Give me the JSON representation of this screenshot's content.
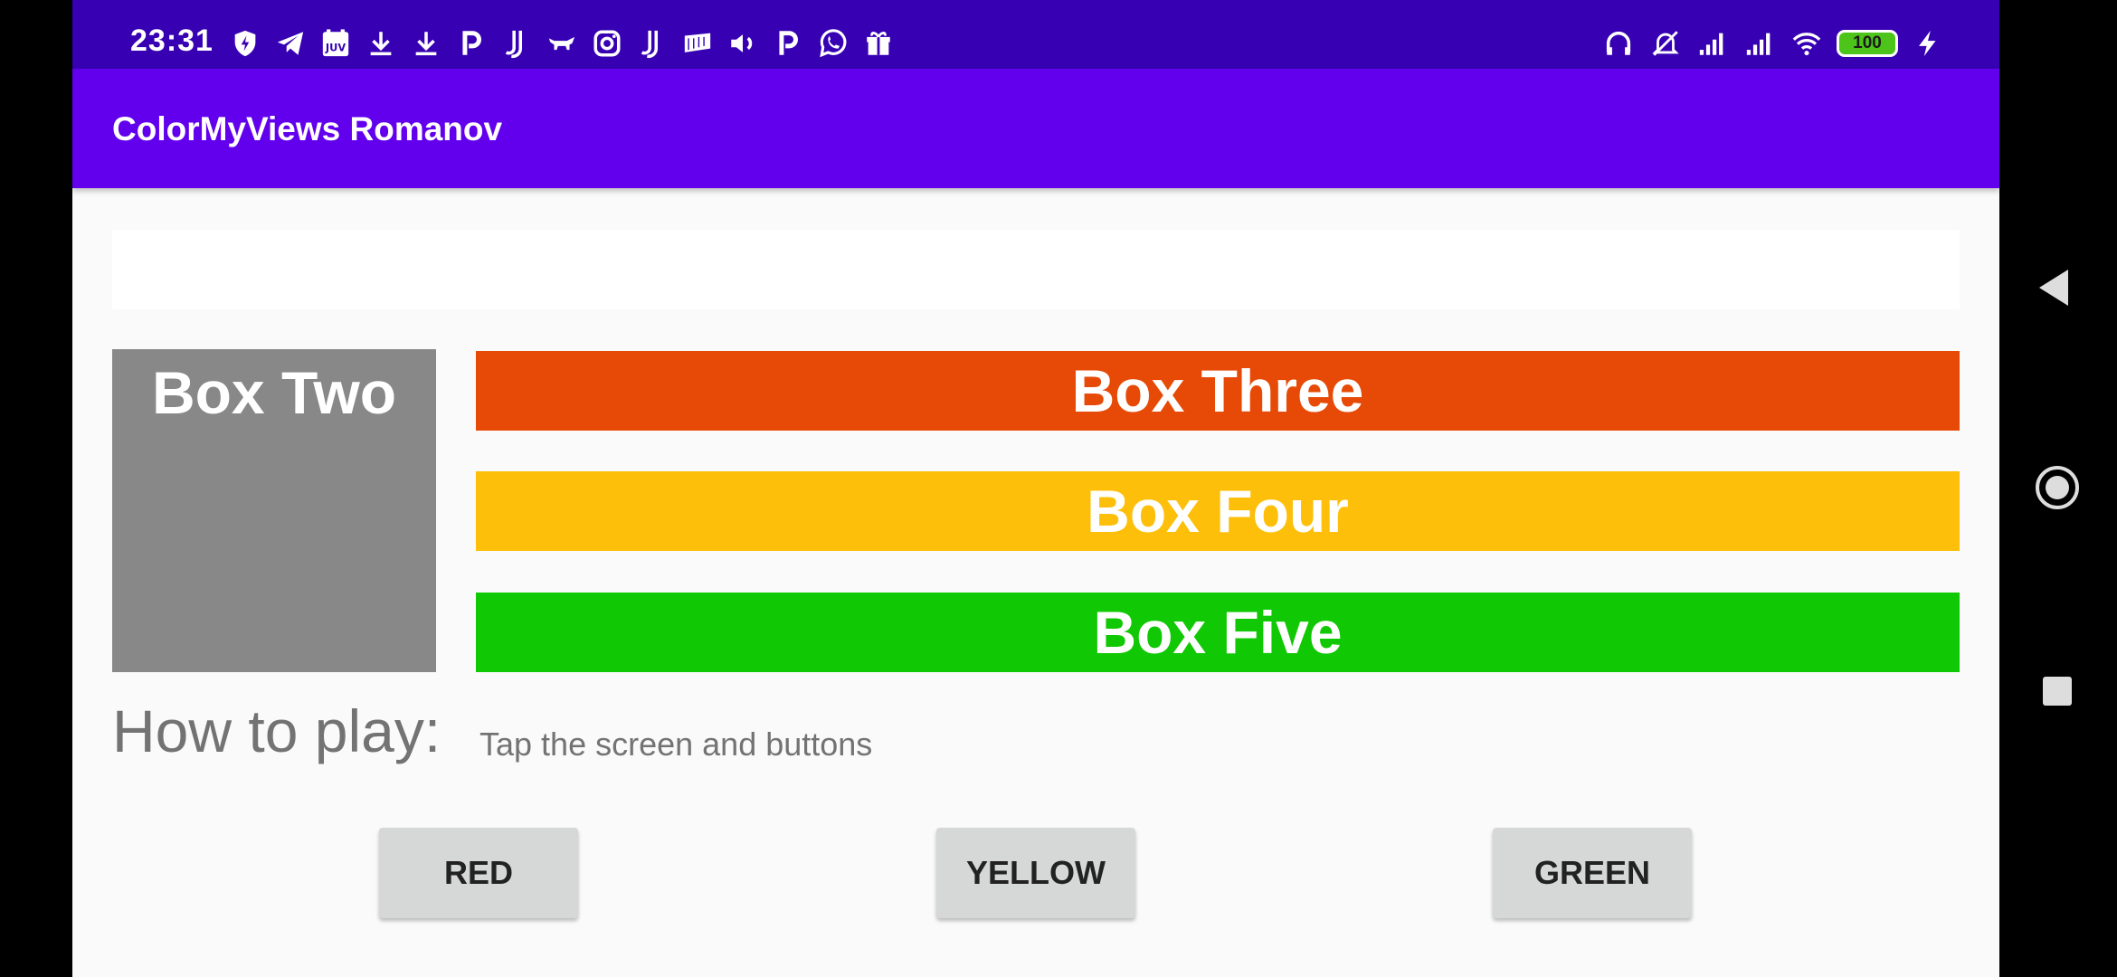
{
  "status_bar": {
    "time": "23:31",
    "battery": "100",
    "left_icons": [
      "shield-icon",
      "telegram-icon",
      "juv-icon",
      "download-icon",
      "download-icon",
      "p-icon",
      "juventus-icon",
      "bull-icon",
      "instagram-icon",
      "juventus-icon",
      "flag-icon",
      "speaker-icon",
      "p-icon",
      "viber-icon",
      "gift-icon"
    ],
    "right_icons": [
      "headphones-icon",
      "mute-bell-icon",
      "signal-icon",
      "signal-icon",
      "wifi-icon",
      "battery-icon",
      "charging-icon"
    ]
  },
  "app_bar": {
    "title": "ColorMyViews Romanov"
  },
  "boxes": {
    "box_two": "Box Two",
    "box_three": "Box Three",
    "box_four": "Box Four",
    "box_five": "Box Five"
  },
  "colors": {
    "status_bar": "#3700b3",
    "app_bar": "#6200ee",
    "box_one": "#ffffff",
    "box_two": "#888888",
    "box_three": "#e64a06",
    "box_four": "#fdbf0a",
    "box_five": "#10c803",
    "button": "#d6d7d7"
  },
  "how_to_play": {
    "label": "How to play:",
    "text": "Tap the screen and buttons"
  },
  "buttons": {
    "red": "RED",
    "yellow": "YELLOW",
    "green": "GREEN"
  }
}
